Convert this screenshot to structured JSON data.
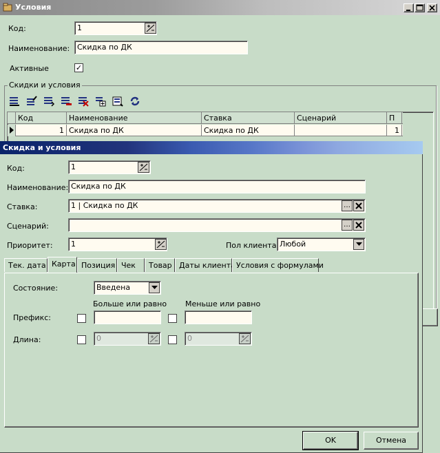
{
  "outer": {
    "title": "Условия",
    "code_label": "Код:",
    "code_value": "1",
    "name_label": "Наименование:",
    "name_value": "Скидка по ДК",
    "active_label": "Активные",
    "active_checked": "✓",
    "group_label": "Скидки и условия",
    "grid": {
      "headers": [
        "Код",
        "Наименование",
        "Ставка",
        "Сценарий",
        "П"
      ],
      "row": [
        "1",
        "Скидка по ДК",
        "Скидка по ДК",
        "",
        "1"
      ]
    }
  },
  "dialog": {
    "title": "Скидка и условия",
    "code_label": "Код:",
    "code_value": "1",
    "name_label": "Наименование:",
    "name_value": "Скидка по ДК",
    "rate_label": "Ставка:",
    "rate_value": "1 | Скидка по ДК",
    "scenario_label": "Сценарий:",
    "scenario_value": "",
    "priority_label": "Приоритет:",
    "priority_value": "1",
    "gender_label": "Пол клиента:",
    "gender_value": "Любой",
    "tabs": [
      "Тек. дата",
      "Карта",
      "Позиция",
      "Чек",
      "Товар",
      "Даты клиента",
      "Условия с формулами"
    ],
    "card": {
      "state_label": "Состояние:",
      "state_value": "Введена",
      "gte_label": "Больше или равно",
      "lte_label": "Меньше или равно",
      "prefix_label": "Префикс:",
      "length_label": "Длина:",
      "length_gte_value": "0",
      "length_lte_value": "0"
    },
    "ok_label": "OK",
    "cancel_label": "Отмена"
  },
  "icons": {
    "window_controls": [
      "minimize-icon",
      "maximize-icon",
      "close-icon"
    ],
    "toolbar": [
      "first-record-icon",
      "edit-record-icon",
      "insert-record-icon",
      "delete-record-icon",
      "delete-all-icon",
      "copy-record-icon",
      "properties-icon",
      "refresh-icon"
    ]
  },
  "colors": {
    "window_bg": "#c8dcc8",
    "field_bg": "#fffbf0",
    "title_dark": "#0a246a",
    "title_light": "#a6caf0"
  }
}
